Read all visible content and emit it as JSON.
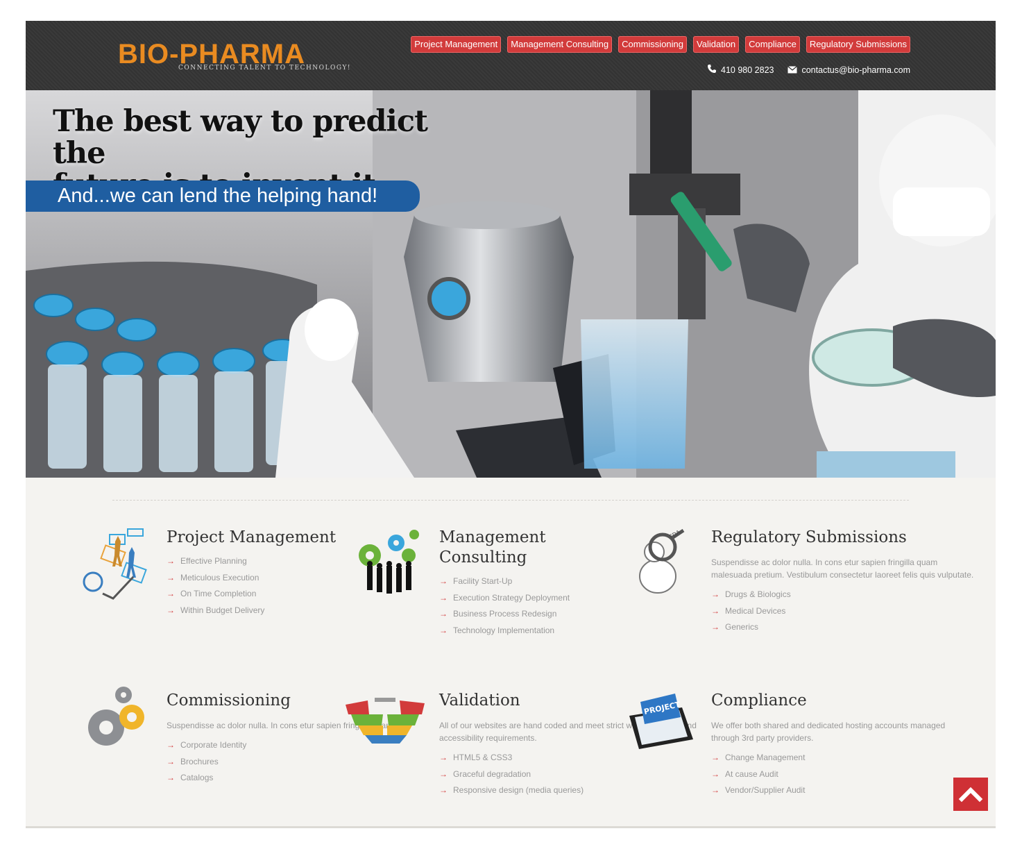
{
  "brand": {
    "name": "BIO-PHARMA",
    "tagline": "CONNECTING TALENT TO TECHNOLOGY!"
  },
  "nav": [
    {
      "label": "Project Management"
    },
    {
      "label": "Management Consulting"
    },
    {
      "label": "Commissioning"
    },
    {
      "label": "Validation"
    },
    {
      "label": "Compliance"
    },
    {
      "label": "Regulatory Submissions"
    }
  ],
  "contact": {
    "phone": "410 980 2823",
    "email": "contactus@bio-pharma.com"
  },
  "hero": {
    "line1": "The best way to predict the",
    "line2": "future is to invent it...",
    "helping": "And...we can lend the helping hand!"
  },
  "services": {
    "project_management": {
      "title": "Project Management",
      "items": [
        "Effective Planning",
        "Meticulous Execution",
        "On Time Completion",
        "Within Budget Delivery"
      ]
    },
    "management_consulting": {
      "title_line1": "Management",
      "title_line2": "Consulting",
      "items": [
        "Facility Start-Up",
        "Execution Strategy Deployment",
        "Business Process Redesign",
        "Technology Implementation"
      ]
    },
    "regulatory_submissions": {
      "title": "Regulatory Submissions",
      "description": "Suspendisse ac dolor nulla. In cons etur sapien fringilla quam malesuada pretium. Vestibulum consectetur laoreet felis quis vulputate.",
      "items": [
        "Drugs & Biologics",
        "Medical Devices",
        "Generics"
      ]
    },
    "commissioning": {
      "title": "Commissioning",
      "description": "Suspendisse ac dolor nulla. In cons etur sapien fringilla quam.",
      "items": [
        "Corporate Identity",
        "Brochures",
        "Catalogs"
      ]
    },
    "validation": {
      "title": "Validation",
      "description": "All of our websites are hand coded and meet strict web standards and accessibility requirements.",
      "items": [
        "HTML5 & CSS3",
        "Graceful degradation",
        "Responsive design (media queries)"
      ]
    },
    "compliance": {
      "title": "Compliance",
      "description": "We offer both shared and dedicated hosting accounts managed through 3rd party providers.",
      "items": [
        "Change Management",
        "At cause Audit",
        "Vendor/Supplier Audit"
      ]
    }
  },
  "icon_labels": {
    "fda": "FDA",
    "project": "PROJECT"
  },
  "colors": {
    "accent": "#d23b3b",
    "brand_orange": "#e98b21",
    "hero_banner": "#1f5ea1",
    "header_bg": "#363636"
  }
}
